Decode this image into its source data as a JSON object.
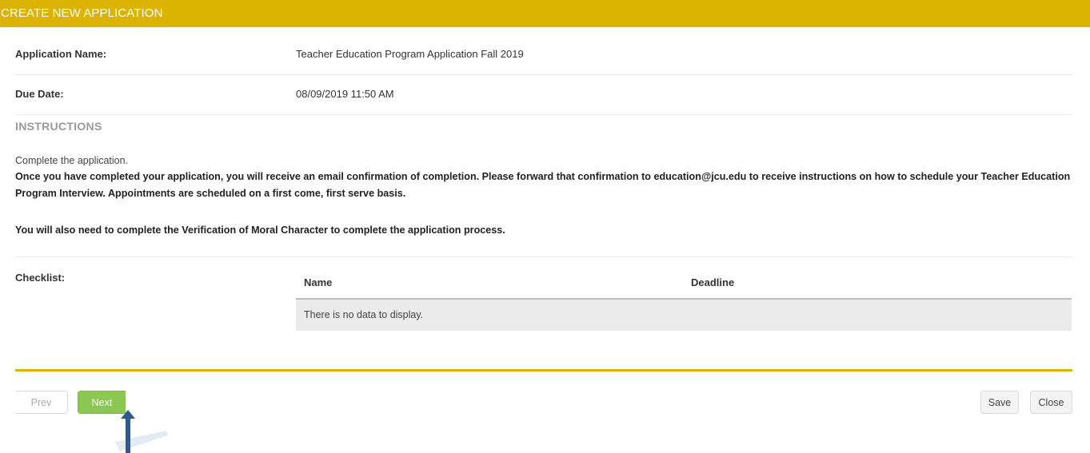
{
  "header": {
    "title": "CREATE NEW APPLICATION",
    "bar_color": "#dbb300"
  },
  "fields": {
    "application_name_label": "Application Name:",
    "application_name_value": "Teacher Education Program Application Fall 2019",
    "due_date_label": "Due Date:",
    "due_date_value": "08/09/2019 11:50 AM"
  },
  "instructions": {
    "heading": "INSTRUCTIONS",
    "line1": "Complete the application.",
    "line2": "Once you have completed your application, you will receive an email confirmation of completion. Please forward that confirmation to education@jcu.edu to receive instructions on how to schedule your Teacher Education Program Interview. Appointments are scheduled on a first come, first serve basis.",
    "line3": "You will also need to complete the Verification of Moral Character to complete the application process."
  },
  "checklist": {
    "label": "Checklist:",
    "columns": [
      "Name",
      "Deadline"
    ],
    "empty_message": "There is no data to display."
  },
  "footer": {
    "prev_label": "Prev",
    "next_label": "Next",
    "save_label": "Save",
    "close_label": "Close",
    "next_color": "#8cc653"
  },
  "annotation": {
    "icon": "up-arrow-pointer-icon",
    "color": "#2e5a8c"
  }
}
